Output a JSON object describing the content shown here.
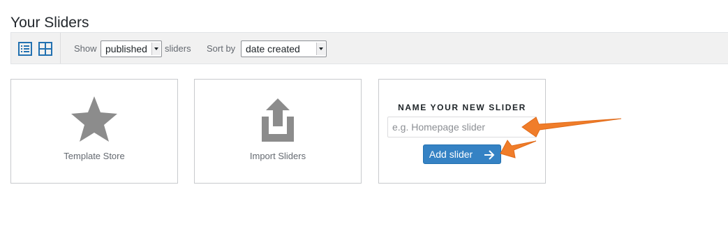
{
  "page": {
    "title": "Your Sliders"
  },
  "toolbar": {
    "view_icons": [
      "list-view-icon",
      "grid-view-icon"
    ],
    "show_label": "Show",
    "status_select": {
      "value": "published"
    },
    "sliders_label": "sliders",
    "sort_label": "Sort by",
    "sort_select": {
      "value": "date created"
    }
  },
  "cards": {
    "template_store": {
      "label": "Template Store",
      "icon": "star-icon"
    },
    "import": {
      "label": "Import Sliders",
      "icon": "upload-icon"
    },
    "new_slider": {
      "title": "NAME YOUR NEW SLIDER",
      "input_placeholder": "e.g. Homepage slider",
      "input_value": "",
      "button_label": "Add slider",
      "button_icon": "arrow-right-icon"
    }
  },
  "colors": {
    "accent": "#3582c4",
    "annotation_arrow": "#f07d2a",
    "icon_gray": "#8c8c8c",
    "view_icon_blue": "#2271b1"
  }
}
